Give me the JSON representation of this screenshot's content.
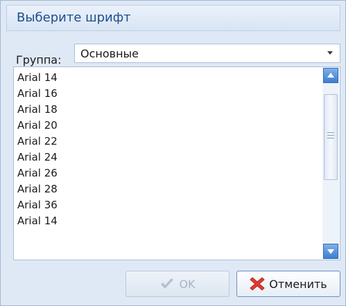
{
  "window": {
    "title": "Выберите шрифт"
  },
  "group": {
    "label": "Группа:",
    "selected": "Основные"
  },
  "fonts": {
    "items": [
      "Arial 14",
      "Arial 16",
      "Arial 18",
      "Arial 20",
      "Arial 22",
      "Arial 24",
      "Arial 26",
      "Arial 28",
      "Arial 36",
      "Arial 14"
    ]
  },
  "buttons": {
    "ok_label": "OK",
    "cancel_label": "Отменить"
  },
  "icons": {
    "ok": "checkmark-icon",
    "cancel": "red-x-icon",
    "dropdown": "chevron-down-icon",
    "scroll_up": "arrow-up-icon",
    "scroll_down": "arrow-down-icon"
  },
  "colors": {
    "title_text": "#1e4e8c",
    "dialog_bg": "#dfe9f5",
    "cancel_x": "#e23b2e",
    "ok_check_disabled": "#b6c1cf",
    "scroll_button": "#3d7fd0"
  }
}
